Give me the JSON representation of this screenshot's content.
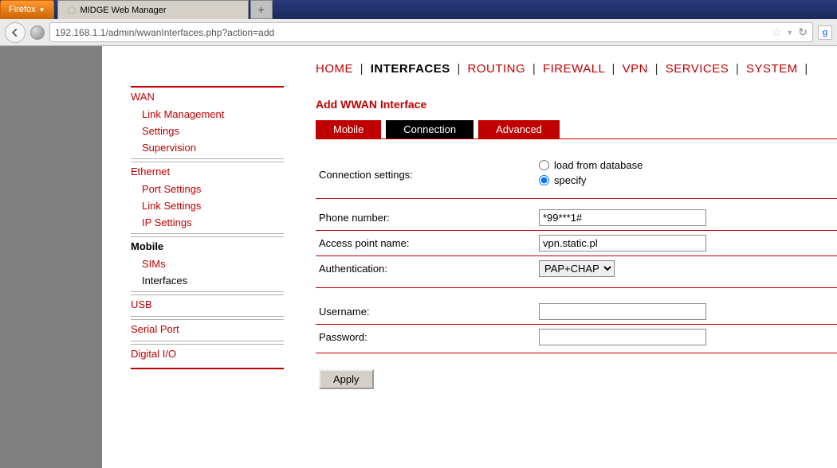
{
  "browser": {
    "firefox_label": "Firefox",
    "tab_title": "MIDGE Web Manager",
    "new_tab": "+",
    "url": "192.168.1.1/admin/wwanInterfaces.php?action=add"
  },
  "topnav": {
    "items": [
      "HOME",
      "INTERFACES",
      "ROUTING",
      "FIREWALL",
      "VPN",
      "SERVICES",
      "SYSTEM"
    ],
    "active": "INTERFACES"
  },
  "sidebar": {
    "sections": [
      {
        "head": "WAN",
        "items": [
          "Link Management",
          "Settings",
          "Supervision"
        ]
      },
      {
        "head": "Ethernet",
        "items": [
          "Port Settings",
          "Link Settings",
          "IP Settings"
        ]
      },
      {
        "head": "Mobile",
        "active": true,
        "items": [
          "SIMs",
          "Interfaces"
        ],
        "active_item": "Interfaces"
      },
      {
        "head": "USB",
        "items": []
      },
      {
        "head": "Serial Port",
        "items": []
      },
      {
        "head": "Digital I/O",
        "items": []
      }
    ]
  },
  "page_title": "Add WWAN Interface",
  "tabs": {
    "mobile": "Mobile",
    "connection": "Connection",
    "advanced": "Advanced",
    "active": "Connection"
  },
  "form": {
    "conn_settings_label": "Connection settings:",
    "radio_load": "load from database",
    "radio_specify": "specify",
    "phone_label": "Phone number:",
    "phone_value": "*99***1#",
    "apn_label": "Access point name:",
    "apn_value": "vpn.static.pl",
    "auth_label": "Authentication:",
    "auth_value": "PAP+CHAP",
    "user_label": "Username:",
    "user_value": "",
    "pass_label": "Password:",
    "pass_value": "",
    "apply": "Apply"
  }
}
